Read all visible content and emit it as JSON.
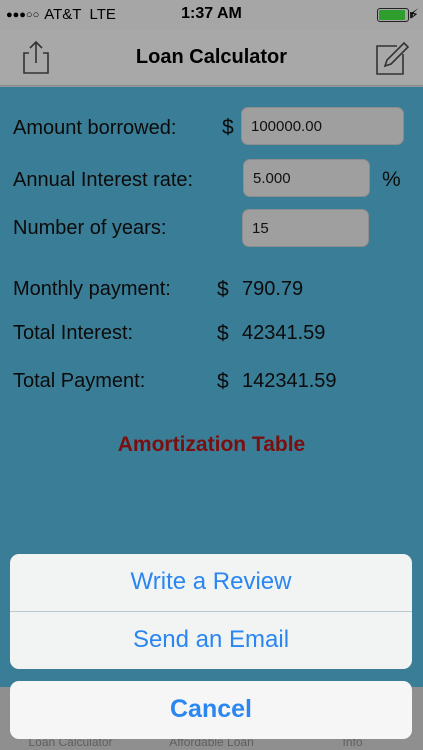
{
  "status_bar": {
    "signal_dots": "●●●○○",
    "carrier": "AT&T",
    "network": "LTE",
    "time": "1:37 AM",
    "battery_level": 0.86,
    "charging_icon": "bolt-icon"
  },
  "nav": {
    "title": "Loan Calculator",
    "left_icon": "share-icon",
    "right_icon": "compose-icon"
  },
  "form": {
    "amount_label": "Amount borrowed:",
    "amount_currency": "$",
    "amount_value": "100000.00",
    "rate_label": "Annual Interest rate:",
    "rate_value": "5.000",
    "rate_unit": "%",
    "years_label": "Number of years:",
    "years_value": "15"
  },
  "results": {
    "monthly_label": "Monthly payment:",
    "monthly_currency": "$",
    "monthly_value": "790.79",
    "interest_label": "Total Interest:",
    "interest_currency": "$",
    "interest_value": "42341.59",
    "payment_label": "Total Payment:",
    "payment_currency": "$",
    "payment_value": "142341.59"
  },
  "amortization_link": "Amortization Table",
  "tabs": [
    {
      "label": "Loan Calculator"
    },
    {
      "label": "Affordable Loan"
    },
    {
      "label": "Info"
    }
  ],
  "action_sheet": {
    "items": [
      {
        "label": "Write a Review"
      },
      {
        "label": "Send an Email"
      }
    ],
    "cancel_label": "Cancel"
  },
  "colors": {
    "content_background": "#3a7d96",
    "accent_blue": "#2a86f0",
    "amortization_red": "#7a0f0f"
  }
}
